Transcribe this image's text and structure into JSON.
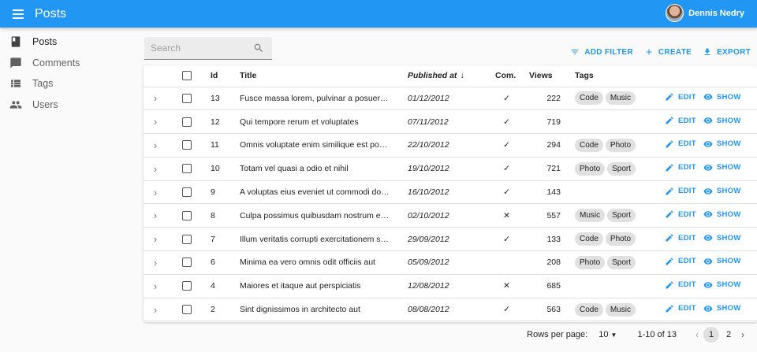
{
  "appbar": {
    "title": "Posts",
    "user_name": "Dennis Nedry"
  },
  "sidebar": {
    "items": [
      {
        "label": "Posts",
        "icon": "book-icon",
        "active": true
      },
      {
        "label": "Comments",
        "icon": "comment-icon",
        "active": false
      },
      {
        "label": "Tags",
        "icon": "list-icon",
        "active": false
      },
      {
        "label": "Users",
        "icon": "people-icon",
        "active": false
      }
    ]
  },
  "search": {
    "placeholder": "Search",
    "value": ""
  },
  "toolbar": {
    "add_filter": "ADD FILTER",
    "create": "CREATE",
    "export": "EXPORT"
  },
  "table": {
    "headers": {
      "id": "Id",
      "title": "Title",
      "published": "Published at",
      "published_sort": "↓",
      "com": "Com.",
      "views": "Views",
      "tags": "Tags"
    },
    "edit_label": "EDIT",
    "show_label": "SHOW",
    "rows": [
      {
        "id": "13",
        "title": "Fusce massa lorem, pulvinar a posuere…",
        "published": "01/12/2012",
        "com": "✓",
        "views": "222",
        "tags": [
          "Code",
          "Music"
        ]
      },
      {
        "id": "12",
        "title": "Qui tempore rerum et voluptates",
        "published": "07/11/2012",
        "com": "✓",
        "views": "719",
        "tags": []
      },
      {
        "id": "11",
        "title": "Omnis voluptate enim similique est po…",
        "published": "22/10/2012",
        "com": "✓",
        "views": "294",
        "tags": [
          "Code",
          "Photo"
        ]
      },
      {
        "id": "10",
        "title": "Totam vel quasi a odio et nihil",
        "published": "19/10/2012",
        "com": "✓",
        "views": "721",
        "tags": [
          "Photo",
          "Sport"
        ]
      },
      {
        "id": "9",
        "title": "A voluptas eius eveniet ut commodi do…",
        "published": "16/10/2012",
        "com": "✓",
        "views": "143",
        "tags": []
      },
      {
        "id": "8",
        "title": "Culpa possimus quibusdam nostrum e…",
        "published": "02/10/2012",
        "com": "✕",
        "views": "557",
        "tags": [
          "Music",
          "Sport"
        ]
      },
      {
        "id": "7",
        "title": "Illum veritatis corrupti exercitationem s…",
        "published": "29/09/2012",
        "com": "✓",
        "views": "133",
        "tags": [
          "Code",
          "Photo"
        ]
      },
      {
        "id": "6",
        "title": "Minima ea vero omnis odit officiis aut",
        "published": "05/09/2012",
        "com": "",
        "views": "208",
        "tags": [
          "Photo",
          "Sport"
        ]
      },
      {
        "id": "4",
        "title": "Maiores et itaque aut perspiciatis",
        "published": "12/08/2012",
        "com": "✕",
        "views": "685",
        "tags": []
      },
      {
        "id": "2",
        "title": "Sint dignissimos in architecto aut",
        "published": "08/08/2012",
        "com": "✓",
        "views": "563",
        "tags": [
          "Code",
          "Music"
        ]
      }
    ]
  },
  "pagination": {
    "rows_per_page_label": "Rows per page:",
    "rows_per_page": "10",
    "range": "1-10 of 13",
    "pages": [
      "1",
      "2"
    ],
    "current_page": "1"
  },
  "colors": {
    "primary": "#2196f3"
  }
}
